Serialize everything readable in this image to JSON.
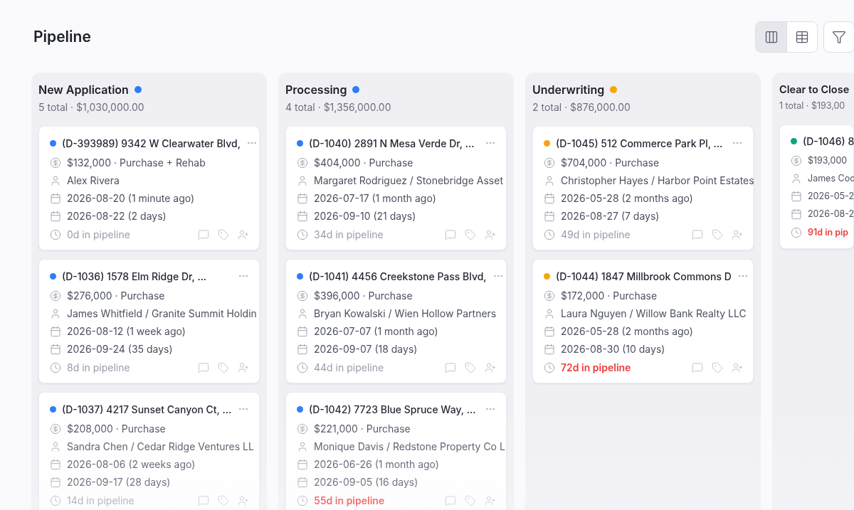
{
  "title": "Pipeline",
  "view_toggle": [
    {
      "kind": "board",
      "selected": true
    },
    {
      "kind": "table",
      "selected": false
    }
  ],
  "columns": [
    {
      "name": "New Application",
      "color": "#2f7cf6",
      "summary": "5 total · $1,030,000.00",
      "cards": [
        {
          "title": "(D-393989) 9342 W Clearwater Blvd,",
          "amount": "$132,000 · Purchase + Rehab",
          "contact": "Alex Rivera",
          "created": "2026-08-20 (1 minute ago)",
          "due": "2026-08-22 (2 days)",
          "pipeline": "0d in pipeline",
          "overdue": false
        },
        {
          "title": "(D-1036) 1578 Elm Ridge Dr, ...",
          "amount": "$276,000 · Purchase",
          "contact": "James Whitfield / Granite Summit Holdin",
          "created": "2026-08-12 (1 week ago)",
          "due": "2026-09-24 (35 days)",
          "pipeline": "8d in pipeline",
          "overdue": false
        },
        {
          "title": "(D-1037) 4217 Sunset Canyon Ct, ...",
          "amount": "$208,000 · Purchase",
          "contact": "Sandra Chen / Cedar Ridge Ventures LL",
          "created": "2026-08-06 (2 weeks ago)",
          "due": "2026-09-17 (28 days)",
          "pipeline": "14d in pipeline",
          "overdue": false
        }
      ]
    },
    {
      "name": "Processing",
      "color": "#2f7cf6",
      "summary": "4 total · $1,356,000.00",
      "cards": [
        {
          "title": "(D-1040) 2891 N Mesa Verde Dr, ...",
          "amount": "$404,000 · Purchase",
          "contact": "Margaret Rodriguez / Stonebridge Asset",
          "created": "2026-07-17 (1 month ago)",
          "due": "2026-09-10 (21 days)",
          "pipeline": "34d in pipeline",
          "overdue": false
        },
        {
          "title": "(D-1041) 4456 Creekstone Pass Blvd,",
          "amount": "$396,000 · Purchase",
          "contact": "Bryan Kowalski / Wien Hollow Partners",
          "created": "2026-07-07 (1 month ago)",
          "due": "2026-09-07 (18 days)",
          "pipeline": "44d in pipeline",
          "overdue": false
        },
        {
          "title": "(D-1042) 7723 Blue Spruce Way, ...",
          "amount": "$221,000 · Purchase",
          "contact": "Monique Davis / Redstone Property Co L",
          "created": "2026-06-26 (1 month ago)",
          "due": "2026-09-05 (16 days)",
          "pipeline": "55d in pipeline",
          "overdue": true
        }
      ]
    },
    {
      "name": "Underwriting",
      "color": "#f5a60b",
      "summary": "2 total · $876,000.00",
      "cards": [
        {
          "title": "(D-1045) 512 Commerce Park Pl, ...",
          "amount": "$704,000 · Purchase",
          "contact": "Christopher Hayes / Harbor Point Estates",
          "created": "2026-05-28 (2 months ago)",
          "due": "2026-08-27 (7 days)",
          "pipeline": "49d in pipeline",
          "overdue": false
        },
        {
          "title": "(D-1044) 1847 Millbrook Commons D",
          "amount": "$172,000 · Purchase",
          "contact": "Laura Nguyen / Willow Bank Realty LLC",
          "created": "2026-05-28 (2 months ago)",
          "due": "2026-08-30 (10 days)",
          "pipeline": "72d in pipeline",
          "overdue": true
        }
      ]
    },
    {
      "name": "Clear to Close",
      "color": "#10a37f",
      "summary": "1 total · $193,00",
      "cards": [
        {
          "title": "(D-1046) 8",
          "amount": "$193,000",
          "contact": "James Coo",
          "created": "2026-05-2",
          "due": "2026-08-2",
          "pipeline": "91d in pip",
          "overdue": true
        }
      ]
    }
  ]
}
